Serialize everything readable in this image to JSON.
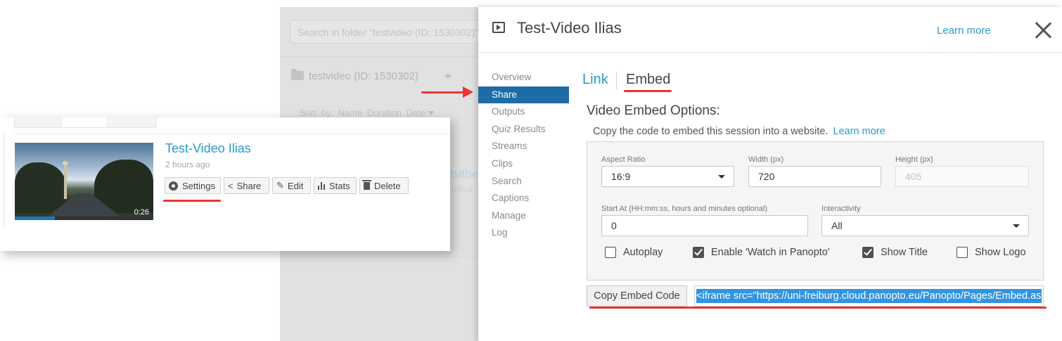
{
  "background_folder": {
    "search_placeholder": "Search in folder \"testvideo (ID: 1530302)\"",
    "folder_name": "testvideo (ID: 1530302)",
    "sort_label": "Sort by:",
    "sort_options": [
      "Name",
      "Duration",
      "Date"
    ],
    "partial_link": "visitbe",
    "partial_text": "minut"
  },
  "session_card": {
    "title": "Test-Video Ilias",
    "age": "2 hours ago",
    "duration": "0:26",
    "progress_fraction": 0.29,
    "actions": [
      {
        "label": "Settings",
        "icon": "gear-icon"
      },
      {
        "label": "Share",
        "icon": "share-icon"
      },
      {
        "label": "Edit",
        "icon": "pencil-icon"
      },
      {
        "label": "Stats",
        "icon": "bar-chart-icon"
      },
      {
        "label": "Delete",
        "icon": "trash-icon"
      }
    ]
  },
  "dialog": {
    "title": "Test-Video Ilias",
    "learn_more": "Learn more",
    "nav": [
      "Overview",
      "Share",
      "Outputs",
      "Quiz Results",
      "Streams",
      "Clips",
      "Search",
      "Captions",
      "Manage",
      "Log"
    ],
    "active_nav": "Share",
    "tabs": {
      "link": "Link",
      "embed": "Embed"
    },
    "embed": {
      "heading": "Video Embed Options:",
      "description": "Copy the code to embed this session into a website.",
      "learn_more": "Learn more",
      "aspect_ratio": {
        "label": "Aspect Ratio",
        "value": "16:9"
      },
      "width": {
        "label": "Width (px)",
        "value": "720"
      },
      "height": {
        "label": "Height (px)",
        "value": "405"
      },
      "start_at": {
        "label": "Start At (HH:mm:ss, hours and minutes optional)",
        "value": "0"
      },
      "interactivity": {
        "label": "Interactivity",
        "value": "All"
      },
      "checkboxes": [
        {
          "label": "Autoplay",
          "checked": false
        },
        {
          "label": "Enable 'Watch in Panopto'",
          "checked": true
        },
        {
          "label": "Show Title",
          "checked": true
        },
        {
          "label": "Show Logo",
          "checked": false
        }
      ],
      "copy_button": "Copy Embed Code",
      "code": "<iframe src=\"https://uni-freiburg.cloud.panopto.eu/Panopto/Pages/Embed.aspx"
    }
  },
  "colors": {
    "accent": "#2b9ac8",
    "nav_active": "#1e6ca6",
    "annotation": "#ee3330",
    "selection": "#3294e0"
  }
}
